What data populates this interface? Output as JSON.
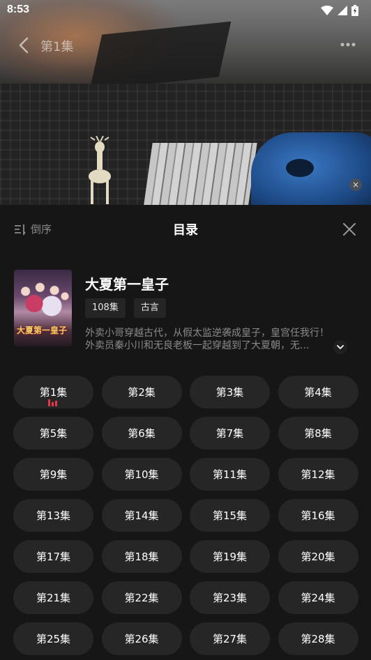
{
  "status_bar": {
    "time": "8:53"
  },
  "player": {
    "title": "第1集"
  },
  "sheet": {
    "sort_label": "倒序",
    "title": "目录"
  },
  "drama": {
    "poster_text": "大夏第一皇子",
    "name": "大夏第一皇子",
    "tags": [
      "108集",
      "古言"
    ],
    "description_line1": "外卖小哥穿越古代，从假太监逆袭成皇子，皇宫任我行！",
    "description_line2": "外卖员秦小川和无良老板一起穿越到了大夏朝，无..."
  },
  "episodes": {
    "current": "第1集",
    "items": [
      "第1集",
      "第2集",
      "第3集",
      "第4集",
      "第5集",
      "第6集",
      "第7集",
      "第8集",
      "第9集",
      "第10集",
      "第11集",
      "第12集",
      "第13集",
      "第14集",
      "第15集",
      "第16集",
      "第17集",
      "第18集",
      "第19集",
      "第20集",
      "第21集",
      "第22集",
      "第23集",
      "第24集",
      "第25集",
      "第26集",
      "第27集",
      "第28集"
    ]
  },
  "colors": {
    "accent": "#e2384a",
    "sheet_bg": "#161616",
    "button_bg": "#262626"
  }
}
